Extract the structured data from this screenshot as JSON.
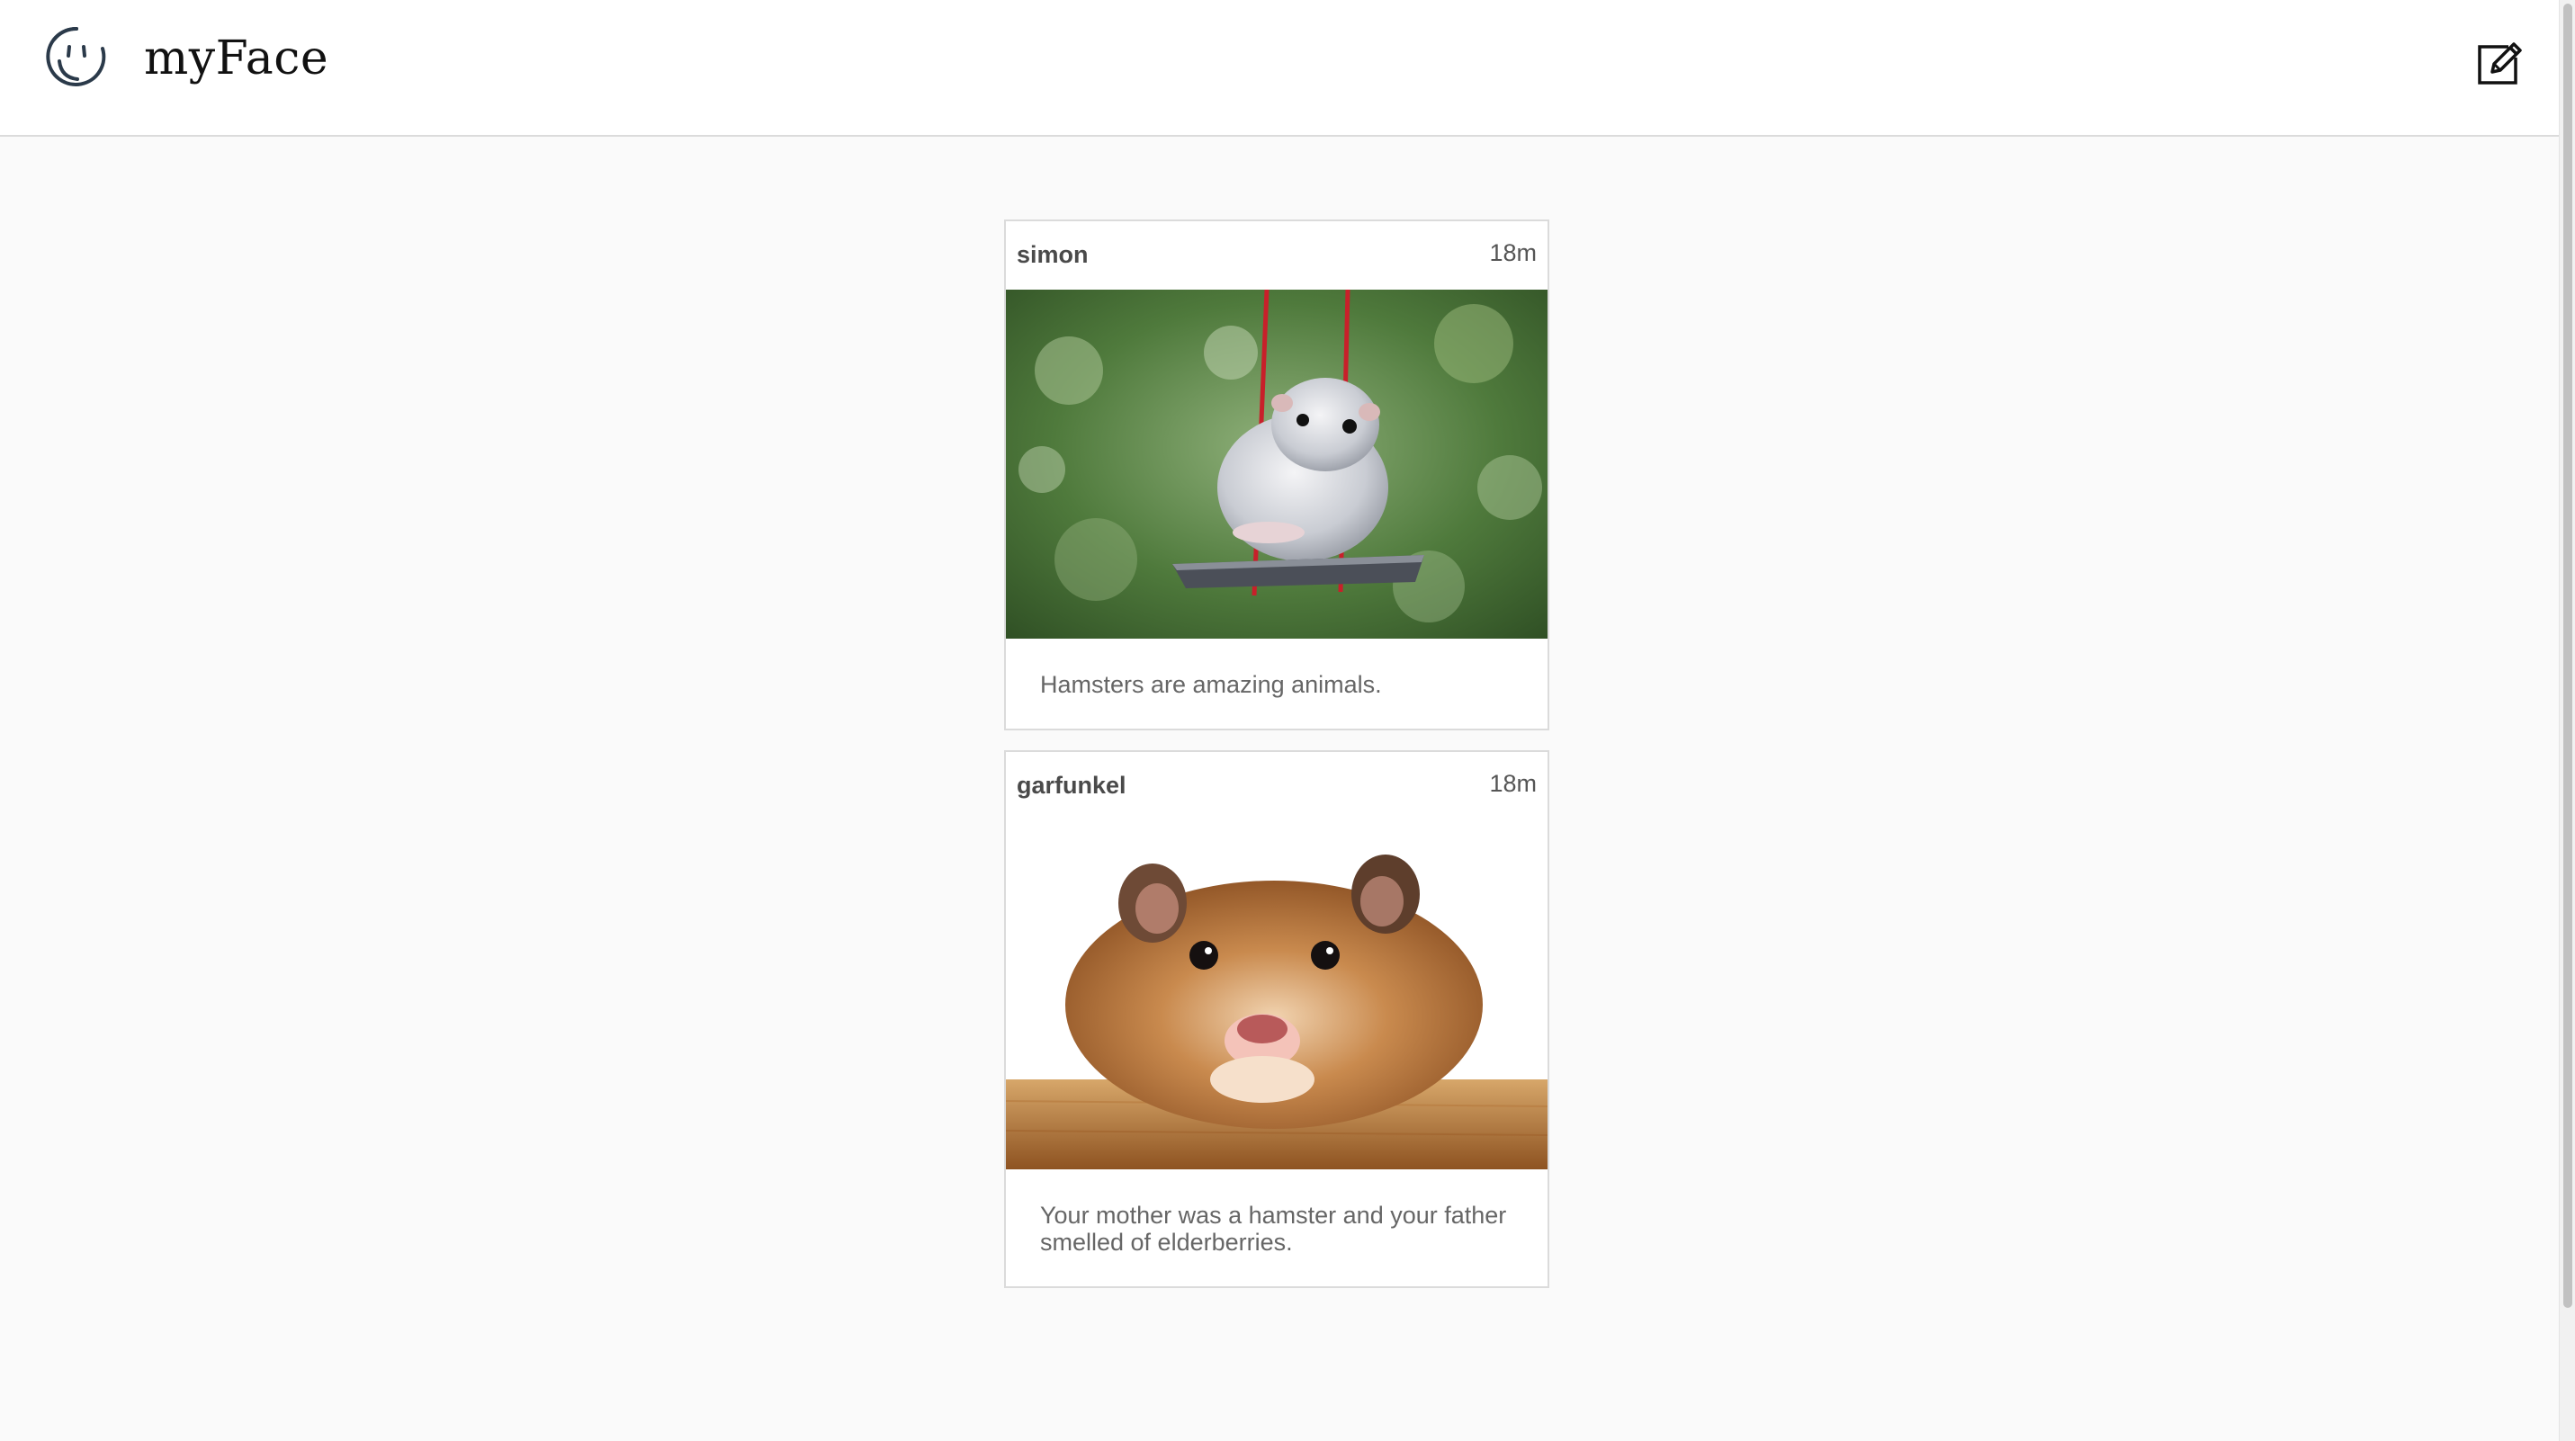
{
  "header": {
    "brand": "myFace",
    "logo_icon": "smiley-face-icon",
    "compose_icon": "compose-edit-icon"
  },
  "posts": [
    {
      "author": "simon",
      "time": "18m",
      "caption": "Hamsters are amazing animals.",
      "image_subject": "grey hamster sitting on a red rope swing against green bokeh background"
    },
    {
      "author": "garfunkel",
      "time": "18m",
      "caption": "Your mother was a hamster and your father smelled of elderberries.",
      "image_subject": "close-up of orange hamster face on wooden ledge with white background"
    }
  ],
  "colors": {
    "page_bg": "#fafafa",
    "header_bg": "#ffffff",
    "border": "#dbdbdb",
    "logo_stroke": "#2b3a4a"
  }
}
